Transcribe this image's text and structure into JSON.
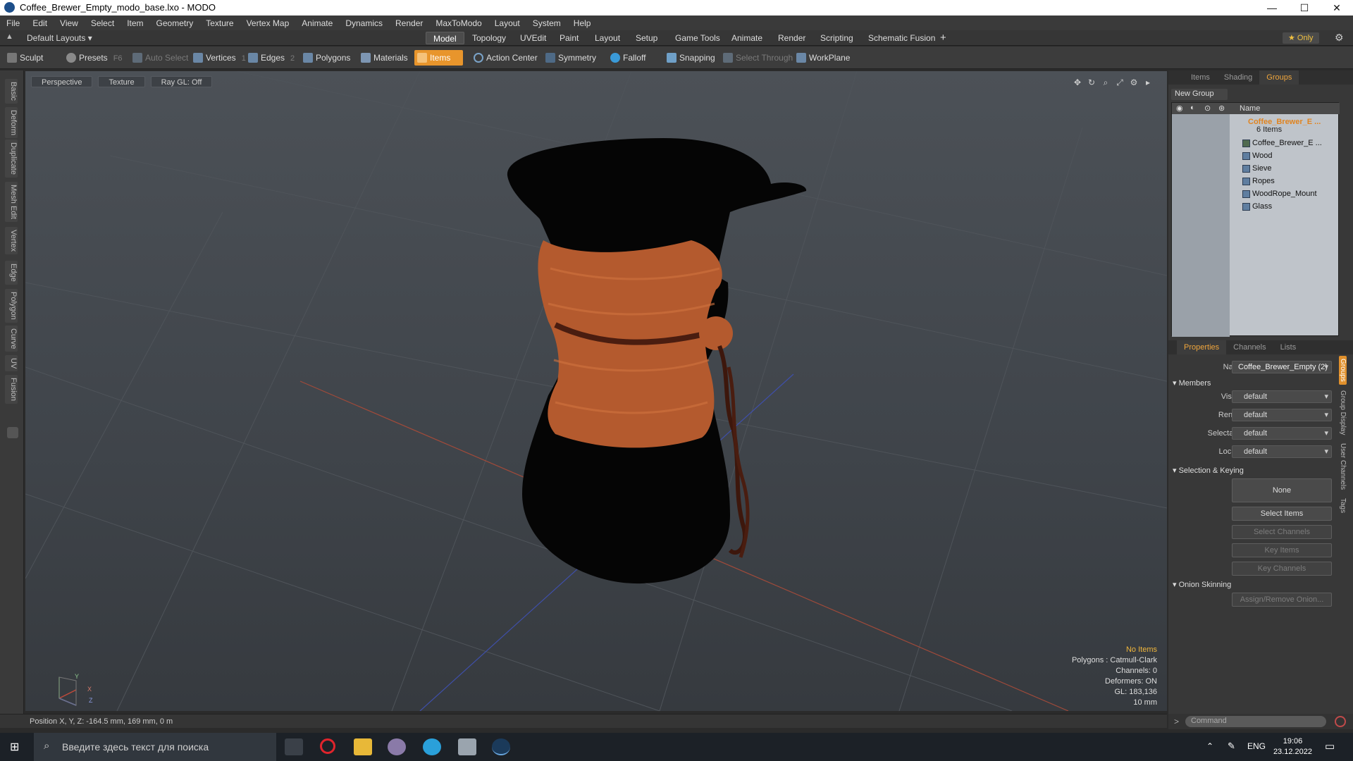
{
  "window": {
    "title": "Coffee_Brewer_Empty_modo_base.lxo - MODO",
    "min": "—",
    "max": "☐",
    "close": "✕"
  },
  "menu": [
    "File",
    "Edit",
    "View",
    "Select",
    "Item",
    "Geometry",
    "Texture",
    "Vertex Map",
    "Animate",
    "Dynamics",
    "Render",
    "MaxToModo",
    "Layout",
    "System",
    "Help"
  ],
  "layoutbar": {
    "layouts": "Default Layouts ▾",
    "tabs": [
      "Model",
      "Topology",
      "UVEdit",
      "Paint",
      "Layout",
      "Setup",
      "Game Tools",
      "Animate",
      "Render",
      "Scripting",
      "Schematic Fusion"
    ],
    "active_tab": "Model",
    "add": "+",
    "only": "★ Only"
  },
  "toolbar": {
    "sculpt": "Sculpt",
    "presets": "Presets",
    "presets_key": "F6",
    "auto_select": "Auto Select",
    "vertices": "Vertices",
    "vertices_key": "1",
    "edges": "Edges",
    "edges_key": "2",
    "polygons": "Polygons",
    "materials": "Materials",
    "items": "Items",
    "action_center": "Action Center",
    "symmetry": "Symmetry",
    "falloff": "Falloff",
    "snapping": "Snapping",
    "select_through": "Select Through",
    "workplane": "WorkPlane"
  },
  "left_tabs": [
    "Basic",
    "Deform",
    "Duplicate",
    "Mesh Edit",
    "Vertex",
    "Edge",
    "Polygon",
    "Curve",
    "UV",
    "Fusion"
  ],
  "viewport": {
    "view": "Perspective",
    "shading": "Texture",
    "raygl": "Ray GL: Off",
    "stats": {
      "no_items": "No Items",
      "polygons": "Polygons : Catmull-Clark",
      "channels": "Channels: 0",
      "deformers": "Deformers: ON",
      "gl": "GL: 183,136",
      "unit": "10 mm"
    },
    "axis": {
      "x": "X",
      "y": "Y",
      "z": "Z"
    }
  },
  "position": "Position X, Y, Z:  -164.5 mm, 169 mm, 0 m",
  "groups_panel": {
    "tabs": [
      "Items",
      "Shading",
      "Groups"
    ],
    "active_tab": "Groups",
    "new_group": "New Group",
    "name_header": "Name",
    "root": {
      "label": "Coffee_Brewer_E ...",
      "sub": "6 Items"
    },
    "items": [
      "Coffee_Brewer_E ...",
      "Wood",
      "Sieve",
      "Ropes",
      "WoodRope_Mount",
      "Glass"
    ]
  },
  "properties": {
    "tabs": [
      "Properties",
      "Channels",
      "Lists"
    ],
    "active_tab": "Properties",
    "name_label": "Name",
    "name_value": "Coffee_Brewer_Empty (2)",
    "members": "Members",
    "fields": [
      {
        "label": "Visible",
        "value": "default"
      },
      {
        "label": "Render",
        "value": "default"
      },
      {
        "label": "Selectable",
        "value": "default"
      },
      {
        "label": "Locked",
        "value": "default"
      }
    ],
    "selection_keying": "Selection & Keying",
    "none": "None",
    "select_items": "Select Items",
    "select_channels": "Select Channels",
    "key_items": "Key Items",
    "key_channels": "Key Channels",
    "onion": "Onion Skinning",
    "assign_onion": "Assign/Remove Onion..."
  },
  "side_tabs": [
    "Groups",
    "Group Display",
    "User Channels",
    "Tags"
  ],
  "command": {
    "prompt": ">",
    "placeholder": "Command"
  },
  "taskbar": {
    "search": "Введите здесь текст для поиска",
    "lang": "ENG",
    "time": "19:06",
    "date": "23.12.2022"
  },
  "colors": {
    "accent": "#e8952c",
    "active_tab_text": "#f0a63c",
    "viewport_bg": "#454a50"
  }
}
